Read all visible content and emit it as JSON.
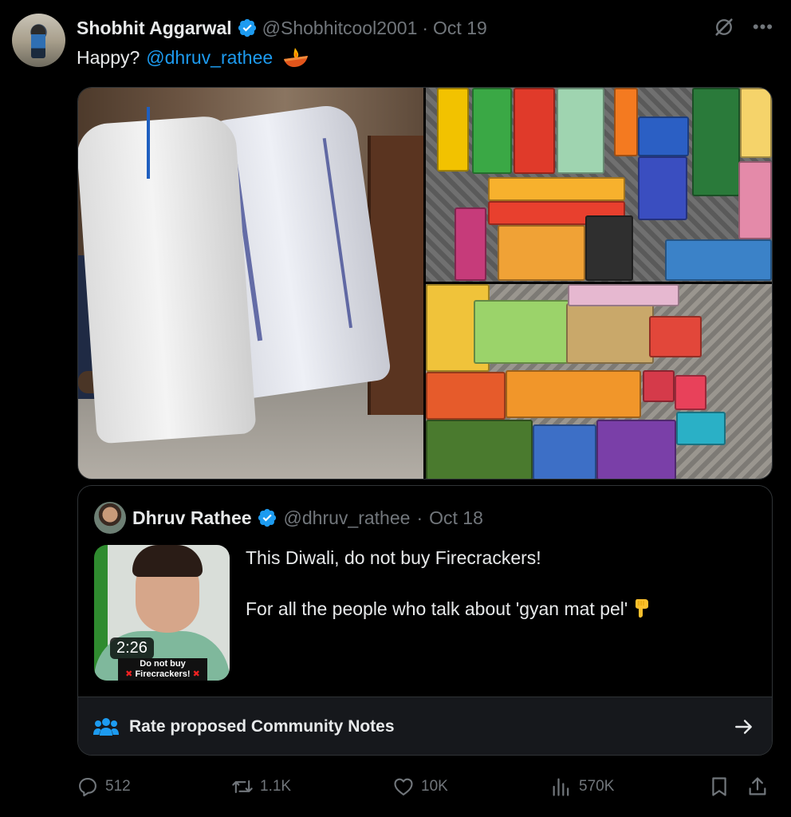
{
  "tweet": {
    "author_name": "Shobhit Aggarwal",
    "handle": "@Shobhitcool2001",
    "date": "Oct 19",
    "text_prefix": "Happy?",
    "mention": "@dhruv_rathee",
    "diya_icon": "diya-lamp-emoji"
  },
  "quoted": {
    "author_name": "Dhruv Rathee",
    "handle": "@dhruv_rathee",
    "date": "Oct 18",
    "line1": "This Diwali, do not buy Firecrackers!",
    "line2": "For all the people who talk about 'gyan mat pel'",
    "video_duration": "2:26",
    "video_caption_line1": "Do not buy",
    "video_caption_line2": "Firecrackers!"
  },
  "community_notes": {
    "label": "Rate proposed Community Notes"
  },
  "actions": {
    "replies": "512",
    "reposts": "1.1K",
    "likes": "10K",
    "views": "570K"
  },
  "colors": {
    "accent": "#1d9bf0",
    "muted": "#71767b",
    "text": "#e7e9ea",
    "background": "#000000"
  }
}
